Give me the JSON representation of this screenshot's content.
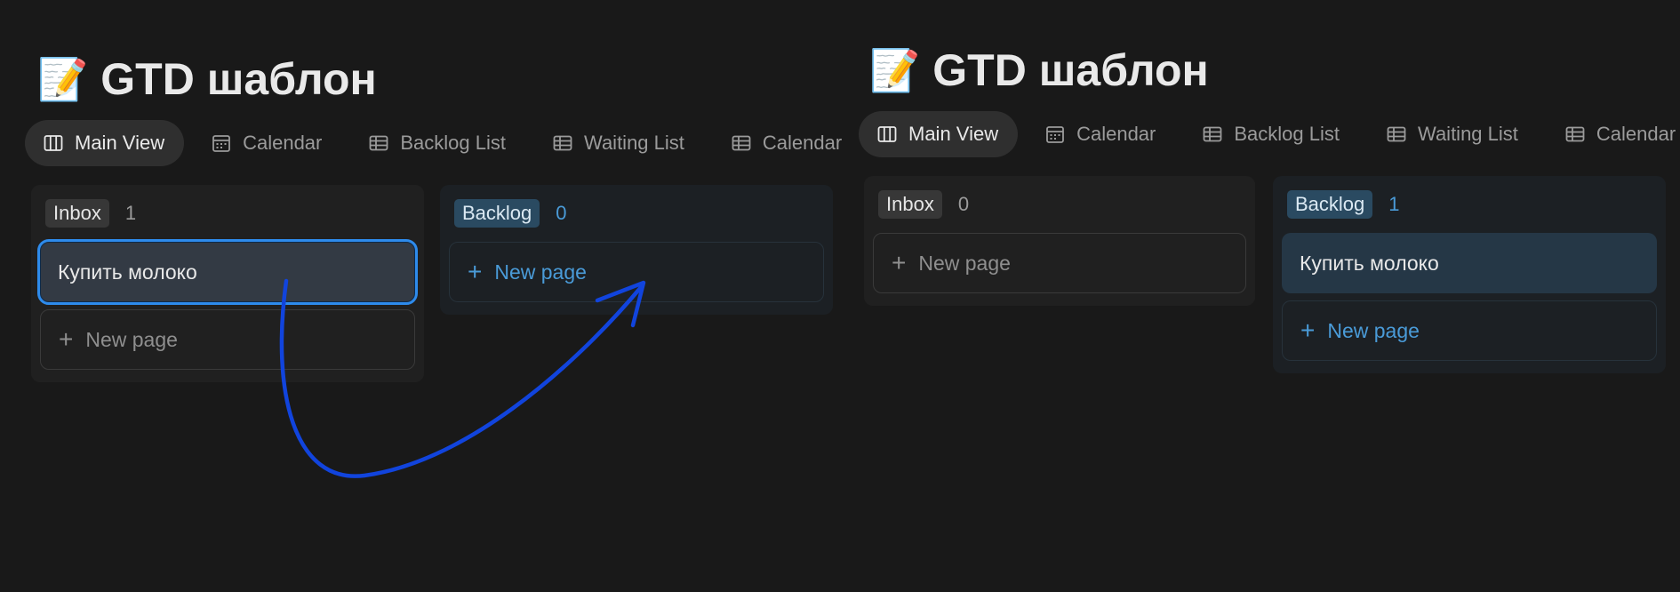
{
  "colors": {
    "background": "#191919",
    "accent": "#2e8bec",
    "backlog_blue": "#4a9bd8",
    "arrow": "#1144dd"
  },
  "icons": {
    "title": "memo-pencil-emoji",
    "board_tab": "board-icon",
    "calendar_tab": "calendar-icon",
    "list_tab": "table-icon",
    "plus": "plus-icon"
  },
  "before": {
    "title_emoji": "📝",
    "title": "GTD шаблон",
    "tabs": [
      "Main View",
      "Calendar",
      "Backlog List",
      "Waiting List",
      "Calendar"
    ],
    "columns": [
      {
        "label": "Inbox",
        "count": "1",
        "cards": [
          "Купить молоко"
        ],
        "new_label": "New page"
      },
      {
        "label": "Backlog",
        "count": "0",
        "cards": [],
        "new_label": "New page"
      }
    ]
  },
  "after": {
    "title_emoji": "📝",
    "title": "GTD шаблон",
    "tabs": [
      "Main View",
      "Calendar",
      "Backlog List",
      "Waiting List",
      "Calendar"
    ],
    "columns": [
      {
        "label": "Inbox",
        "count": "0",
        "cards": [],
        "new_label": "New page"
      },
      {
        "label": "Backlog",
        "count": "1",
        "cards": [
          "Купить молоко"
        ],
        "new_label": "New page"
      }
    ]
  }
}
